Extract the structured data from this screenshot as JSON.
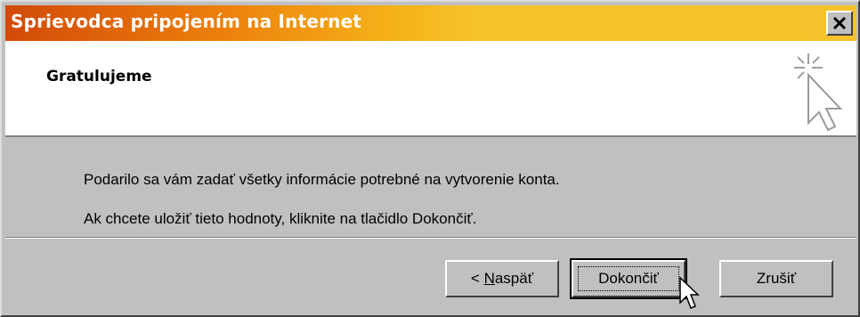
{
  "window": {
    "title": "Sprievodca pripojením na Internet",
    "title_gradient": [
      "#d24a08",
      "#f7c229"
    ]
  },
  "header": {
    "title": "Gratulujeme",
    "icon": "wizard-cursor-sparkle-icon"
  },
  "body": {
    "line1": "Podarilo sa vám zadať všetky informácie potrebné na vytvorenie konta.",
    "line2": "Ak chcete uložiť tieto hodnoty, kliknite na tlačidlo Dokončiť."
  },
  "buttons": {
    "back_prefix": "< ",
    "back_mnemonic": "N",
    "back_rest": "aspäť",
    "finish_label": "Dokončiť",
    "cancel_label": "Zrušiť"
  },
  "icons": {
    "close": "close-icon",
    "mouse_cursor": "mouse-pointer-icon"
  }
}
